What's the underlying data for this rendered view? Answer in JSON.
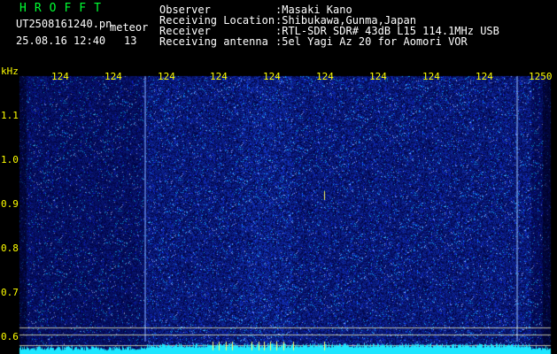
{
  "header": {
    "app_name": "HROFFT",
    "filename": "UT2508161240.pn",
    "suffix": "meteor",
    "datetime": "25.08.16 12:40",
    "count": "13",
    "observer_label": "Observer",
    "observer_value": ":Masaki Kano",
    "location_label": "Receiving Location",
    "location_value": ":Shibukawa,Gunma,Japan",
    "receiver_label": "Receiver",
    "receiver_value": ":RTL-SDR SDR# 43dB L15 114.1MHz USB",
    "antenna_label": "Receiving antenna",
    "antenna_value": ":5el Yagi Az 20 for Aomori VOR"
  },
  "axis": {
    "unit": "kHz",
    "time_ticks": [
      "124",
      "124",
      "124",
      "124",
      "124",
      "124",
      "124",
      "124",
      "124",
      "1250"
    ],
    "freq_ticks": [
      "1.1",
      "1.0",
      "0.9",
      "0.8",
      "0.7",
      "0.6"
    ]
  },
  "colors": {
    "background": "#000000",
    "noise_base": "#0a1a9a",
    "noise_bright": "#8fb4ff",
    "label_yellow": "#ffff00",
    "title_green": "#00ff33",
    "baseline_cyan": "#1ee6ff"
  }
}
